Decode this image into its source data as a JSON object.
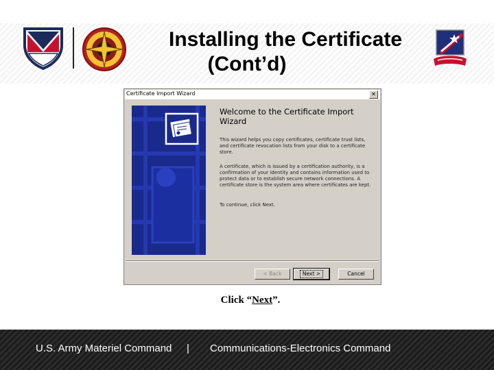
{
  "slide": {
    "title_line1": "Installing the Certificate",
    "title_line2": "(Cont’d)",
    "caption_prefix": "Click “",
    "caption_next": "Next",
    "caption_suffix": "”."
  },
  "logos": {
    "left_logo": "amc-shield-logo",
    "center_logo": "cecom-emblem-logo",
    "right_logo": "unit-insignia-logo"
  },
  "wizard": {
    "title": "Certificate Import Wizard",
    "close_glyph": "✕",
    "heading_line1": "Welcome to the Certificate Import",
    "heading_line2": "Wizard",
    "paragraph1": "This wizard helps you copy certificates, certificate trust lists, and certificate revocation lists from your disk to a certificate store.",
    "paragraph2": "A certificate, which is issued by a certification authority, is a confirmation of your identity and contains information used to protect data or to establish secure network connections. A certificate store is the system area where certificates are kept.",
    "paragraph3": "To continue, click Next.",
    "back_label": "< Back",
    "next_label": "Next >",
    "cancel_label": "Cancel"
  },
  "footer": {
    "left": "U.S. Army Materiel Command",
    "separator": "|",
    "right": "Communications-Electronics Command"
  },
  "colors": {
    "wizard_panel": "#1a2a8c",
    "dialog_face": "#d4d0c8",
    "footer_band": "#222222"
  }
}
